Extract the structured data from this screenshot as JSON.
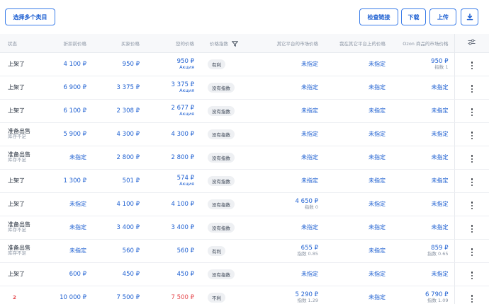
{
  "toolbar": {
    "select_categories": "选择多个类目",
    "check_links": "检查链接",
    "download": "下载",
    "upload": "上传",
    "download_icon": "download-icon"
  },
  "columns": {
    "status": "状态",
    "discount_price": "折扣前价格",
    "sale_price": "买家价格",
    "your_price": "您的价格",
    "price_index": "价格指数",
    "other_market": "其它平台的市场价格",
    "my_other_market": "我在其它平台上的价格",
    "ozon_market": "Ozon 商品的市场价格",
    "settings_icon": "sliders-icon"
  },
  "rows": [
    {
      "status": "上架了",
      "status_sub": "",
      "discount": "4 100 ₽",
      "sale": "950 ₽",
      "your": "950 ₽",
      "your_sub": "Акция",
      "index": "有利",
      "other": "未指定",
      "other_sub": "",
      "mine": "未指定",
      "ozon": "950 ₽",
      "ozon_sub": "指数 1"
    },
    {
      "status": "上架了",
      "status_sub": "",
      "discount": "6 900 ₽",
      "sale": "3 375 ₽",
      "your": "3 375 ₽",
      "your_sub": "Акция",
      "index": "没有指数",
      "other": "未指定",
      "other_sub": "",
      "mine": "未指定",
      "ozon": "未指定",
      "ozon_sub": ""
    },
    {
      "status": "上架了",
      "status_sub": "",
      "discount": "6 100 ₽",
      "sale": "2 308 ₽",
      "your": "2 677 ₽",
      "your_sub": "Акция",
      "index": "没有指数",
      "other": "未指定",
      "other_sub": "",
      "mine": "未指定",
      "ozon": "未指定",
      "ozon_sub": ""
    },
    {
      "status": "准备出售",
      "status_sub": "库存不足",
      "discount": "5 900 ₽",
      "sale": "4 300 ₽",
      "your": "4 300 ₽",
      "your_sub": "",
      "index": "没有指数",
      "other": "未指定",
      "other_sub": "",
      "mine": "未指定",
      "ozon": "未指定",
      "ozon_sub": ""
    },
    {
      "status": "准备出售",
      "status_sub": "库存不足",
      "discount": "未指定",
      "sale": "2 800 ₽",
      "your": "2 800 ₽",
      "your_sub": "",
      "index": "没有指数",
      "other": "未指定",
      "other_sub": "",
      "mine": "未指定",
      "ozon": "未指定",
      "ozon_sub": ""
    },
    {
      "status": "上架了",
      "status_sub": "",
      "discount": "1 300 ₽",
      "sale": "501 ₽",
      "your": "574 ₽",
      "your_sub": "Акция",
      "index": "没有指数",
      "other": "未指定",
      "other_sub": "",
      "mine": "未指定",
      "ozon": "未指定",
      "ozon_sub": ""
    },
    {
      "status": "上架了",
      "status_sub": "",
      "discount": "未指定",
      "sale": "4 100 ₽",
      "your": "4 100 ₽",
      "your_sub": "",
      "index": "没有指数",
      "other": "4 650 ₽",
      "other_sub": "指数 0",
      "mine": "未指定",
      "ozon": "未指定",
      "ozon_sub": ""
    },
    {
      "status": "准备出售",
      "status_sub": "库存不足",
      "discount": "未指定",
      "sale": "3 400 ₽",
      "your": "3 400 ₽",
      "your_sub": "",
      "index": "没有指数",
      "other": "未指定",
      "other_sub": "",
      "mine": "未指定",
      "ozon": "未指定",
      "ozon_sub": ""
    },
    {
      "status": "准备出售",
      "status_sub": "库存不足",
      "discount": "未指定",
      "sale": "560 ₽",
      "your": "560 ₽",
      "your_sub": "",
      "index": "有利",
      "other": "655 ₽",
      "other_sub": "指数 0.85",
      "mine": "未指定",
      "ozon": "859 ₽",
      "ozon_sub": "指数 0.65"
    },
    {
      "status": "上架了",
      "status_sub": "",
      "discount": "600 ₽",
      "sale": "450 ₽",
      "your": "450 ₽",
      "your_sub": "",
      "index": "没有指数",
      "other": "未指定",
      "other_sub": "",
      "mine": "未指定",
      "ozon": "未指定",
      "ozon_sub": ""
    },
    {
      "status": "2",
      "status_sub": "",
      "discount": "10 000 ₽",
      "sale": "7 500 ₽",
      "your": "7 500 ₽",
      "your_sub": "",
      "index": "不利",
      "other": "5 290 ₽",
      "other_sub": "指数 1.29",
      "mine": "未指定",
      "ozon": "6 790 ₽",
      "ozon_sub": "指数 1.09"
    }
  ],
  "colors": {
    "accent": "#1d5fd1",
    "danger": "#e5484d",
    "muted": "#8a94a3"
  }
}
